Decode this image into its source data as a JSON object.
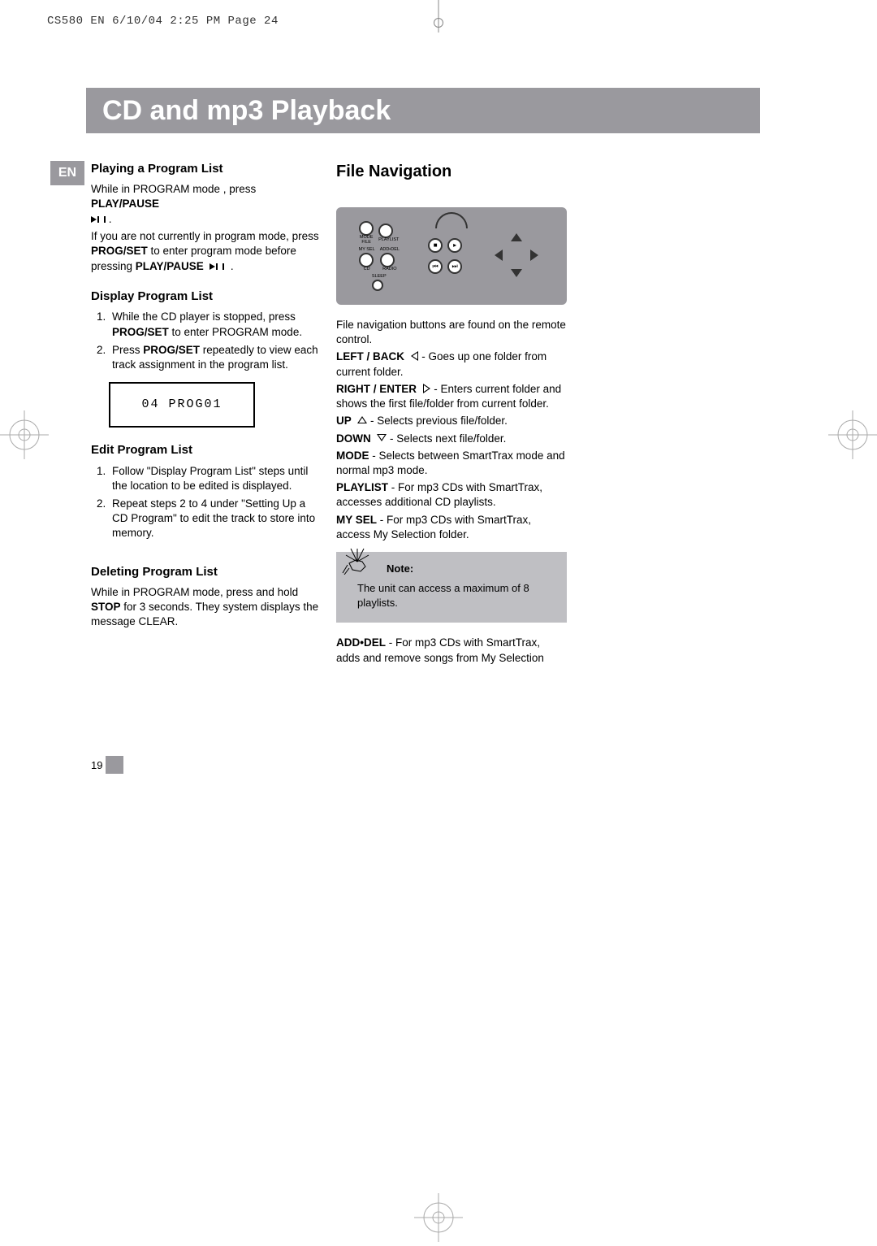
{
  "meta_header": "CS580 EN  6/10/04  2:25 PM  Page 24",
  "main_title": "CD and mp3 Playback",
  "lang_tab": "EN",
  "page_number": "19",
  "left": {
    "h_playing": "Playing a Program List",
    "playing_p1a": "While in PROGRAM mode , press ",
    "playing_p1b": "PLAY/PAUSE",
    "playing_p2a": "If you are not currently in program mode, press ",
    "playing_p2b": "PROG/SET",
    "playing_p2c": " to enter program mode before pressing ",
    "playing_p2d": "PLAY/PAUSE",
    "h_display": "Display Program List",
    "display_li1a": "While the CD player is stopped, press ",
    "display_li1b": "PROG/SET",
    "display_li1c": " to enter PROGRAM mode.",
    "display_li2a": "Press ",
    "display_li2b": "PROG/SET",
    "display_li2c": " repeatedly to view each track assignment  in the program list.",
    "lcd_text": "04 PROG01",
    "h_edit": "Edit Program List",
    "edit_li1": "Follow \"Display Program List\" steps  until the location to be edited is displayed.",
    "edit_li2": "Repeat steps 2 to 4 under \"Setting Up a CD Program\" to edit the track to store into memory.",
    "h_delete": "Deleting Program List",
    "delete_p1a": "While in PROGRAM mode, press and hold ",
    "delete_p1b": "STOP",
    "delete_p1c": " for 3 seconds.  They system displays the message CLEAR."
  },
  "right": {
    "h_filenav": "File Navigation",
    "intro": "File navigation buttons are found on the remote control.",
    "lb1": "LEFT / BACK",
    "lb2": "  - Goes up one folder from current folder.",
    "re1": "RIGHT / ENTER",
    "re2": "  - Enters current folder and shows the first file/folder from current folder.",
    "up1": "UP",
    "up2": " - Selects previous file/folder.",
    "dn1": "DOWN",
    "dn2": " - Selects next file/folder.",
    "mode1": "MODE",
    "mode2": " - Selects between SmartTrax mode and normal mp3 mode.",
    "pl1": "PLAYLIST",
    "pl2": " - For mp3 CDs with SmartTrax, accesses additional CD playlists.",
    "ms1": "MY SEL",
    "ms2": " - For mp3 CDs with SmartTrax, access My Selection folder.",
    "note_label": "Note:",
    "note_body": "The unit can access a maximum of 8 playlists.",
    "ad1": "ADD•DEL",
    "ad2": " - For mp3 CDs with SmartTrax, adds and remove songs from My Selection"
  },
  "remote": {
    "mode": "MODE",
    "file": "FILE",
    "playlist": "PLAYLIST",
    "mysel": "MY SEL",
    "cd": "CD",
    "adddel": "ADD•DEL",
    "radio": "RADIO",
    "sleep": "SLEEP"
  }
}
